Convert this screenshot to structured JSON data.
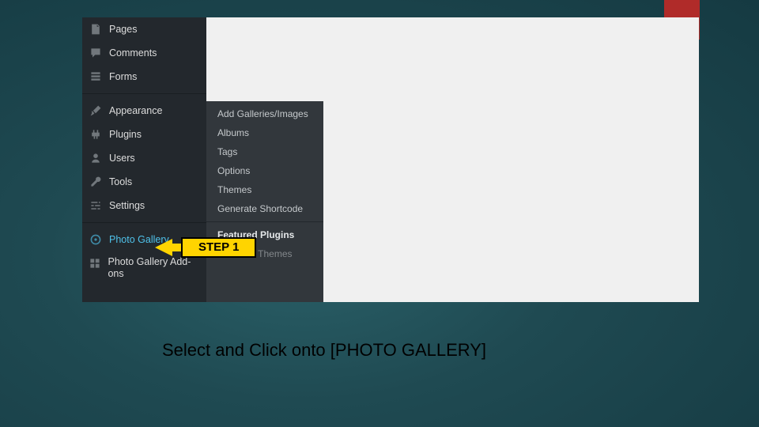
{
  "sidebar": {
    "items": [
      {
        "label": "Pages"
      },
      {
        "label": "Comments"
      },
      {
        "label": "Forms"
      },
      {
        "label": "Appearance"
      },
      {
        "label": "Plugins"
      },
      {
        "label": "Users"
      },
      {
        "label": "Tools"
      },
      {
        "label": "Settings"
      },
      {
        "label": "Photo Gallery"
      },
      {
        "label": "Photo Gallery Add-ons"
      }
    ]
  },
  "submenu": {
    "items": [
      {
        "label": "Add Galleries/Images"
      },
      {
        "label": "Albums"
      },
      {
        "label": "Tags"
      },
      {
        "label": "Options"
      },
      {
        "label": "Themes"
      },
      {
        "label": "Generate Shortcode"
      },
      {
        "label": "Featured Plugins"
      },
      {
        "label": "Featured Themes"
      }
    ]
  },
  "callout": {
    "step_label": "STEP 1"
  },
  "instruction": {
    "text": "Select and Click onto [PHOTO GALLERY]"
  }
}
